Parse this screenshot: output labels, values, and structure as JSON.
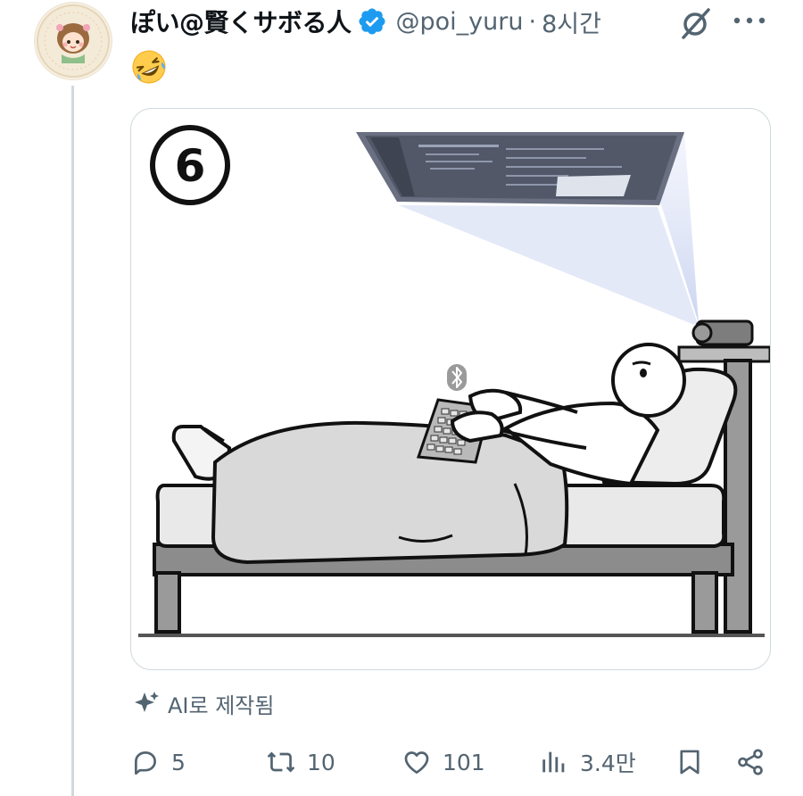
{
  "post": {
    "display_name": "ぽい@賢くサボる人",
    "handle": "@poi_yuru",
    "separator": "·",
    "time": "8시간",
    "body_emoji": "rolling-on-floor-laughing-emoji",
    "media": {
      "number_badge": "⑥",
      "alt": "AI generated illustration"
    },
    "ai_label": "AI로 제작됨",
    "metrics": {
      "replies": "5",
      "reposts": "10",
      "likes": "101",
      "views": "3.4만"
    }
  },
  "icons": {
    "verified": "verified-badge-icon",
    "grok": "grok-icon",
    "more": "more-icon",
    "reply": "reply-icon",
    "repost": "repost-icon",
    "like": "like-icon",
    "views": "views-icon",
    "bookmark": "bookmark-icon",
    "share": "share-icon",
    "sparkle": "sparkle-icon"
  },
  "colors": {
    "verified": "#1d9bf0",
    "secondary_text": "#536471",
    "primary_text": "#0f1419",
    "border": "#cfd9de"
  }
}
